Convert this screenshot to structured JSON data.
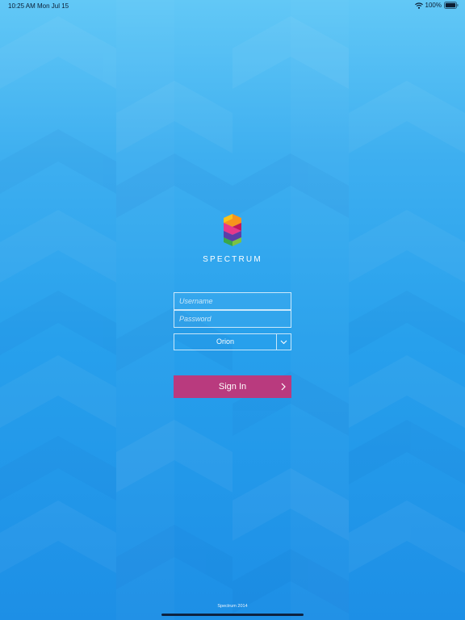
{
  "status_bar": {
    "time": "10:25 AM",
    "date": "Mon Jul 15",
    "battery": "100%",
    "icons": [
      "wifi-icon",
      "battery-icon"
    ]
  },
  "logo": {
    "text": "SPECTRUM",
    "icon": "spectrum-logo-icon"
  },
  "login": {
    "username_placeholder": "Username",
    "password_placeholder": "Password",
    "username_value": "",
    "password_value": "",
    "server_selected": "Orion",
    "server_icon": "chevron-down-icon",
    "sign_in_label": "Sign In",
    "sign_in_icon": "chevron-right-icon"
  },
  "footer": {
    "text": "Spectrum 2014"
  },
  "colors": {
    "background_top": "#62c8f6",
    "background_bottom": "#1d8fe6",
    "sign_in_button": "#b93a7e",
    "field_border": "#ffffff"
  }
}
